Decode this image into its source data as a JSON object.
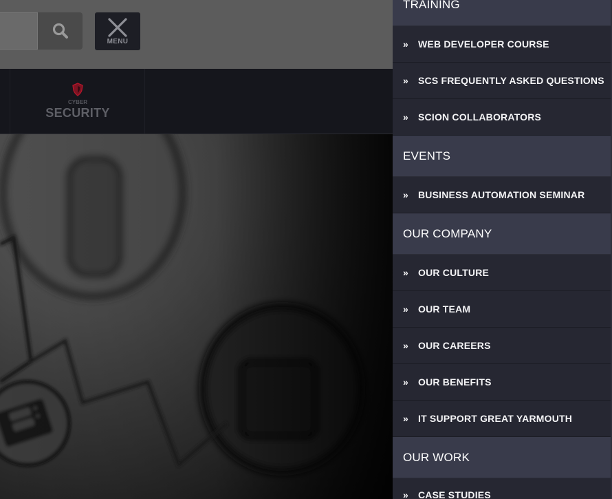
{
  "header": {
    "menu_label": "MENU"
  },
  "navbar": {
    "item": {
      "small": "CYBER",
      "big": "SECURITY"
    }
  },
  "panel": {
    "sections": [
      {
        "title": "TRAINING",
        "items": [
          "WEB DEVELOPER COURSE",
          "SCS FREQUENTLY ASKED QUESTIONS",
          "SCION COLLABORATORS"
        ]
      },
      {
        "title": "EVENTS",
        "items": [
          "BUSINESS AUTOMATION SEMINAR"
        ]
      },
      {
        "title": "OUR COMPANY",
        "items": [
          "OUR CULTURE",
          "OUR TEAM",
          "OUR CAREERS",
          "OUR BENEFITS",
          "IT SUPPORT GREAT YARMOUTH"
        ]
      },
      {
        "title": "OUR WORK",
        "items": [
          "CASE STUDIES"
        ]
      }
    ],
    "bullet": "»"
  },
  "colors": {
    "panel_bg": "#262732",
    "category_bg": "#393b4b",
    "shield_accent": "#b5162b"
  }
}
